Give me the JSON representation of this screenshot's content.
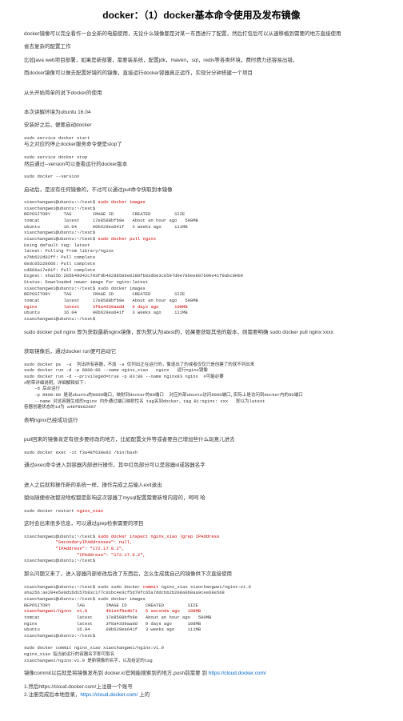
{
  "title": "docker：（1）docker基本命令使用及发布镜像",
  "p1": "docker镜像可以完全看作一台全新的电脑使用，无论什么镜像都是对某一东西进行了配置，然后打包后可以从速移植到需要的地方直接使用",
  "p2": "省去复杂的配置工作",
  "p3": "比如java web项目部署，如果是新部署，需要装系统，配置jdk，maven，sql，redis等各类环境，费时费力还容易出错，",
  "p4": "而docker镜像可以做去配置好镜的的镜像，直接运行docker容器真正运作，实现分分钟搭建一个项目",
  "p5": "从头开始简单的说下docker的使用",
  "p6": "本次讲解环境为ubuntu 16.04",
  "p7": "安装好之后，便要启动docker",
  "c8": "sudo service docker start",
  "p9": "与之对应的停止docker服务命令便是stop了",
  "c10": "sudo service docker stop",
  "p11": "然后通过--version可以查看运行的docker版本",
  "c12": "sudo docker --version",
  "p13": "启动后，是没有任何镜像的，不过可以通过pull命令快取到本镜像",
  "cmd1_line1": "xiaochangwei@ubuntu:~/test$ ",
  "cmd1_line1_red": "sudo docker images",
  "cmd1_line2": "xiaochangwei@ubuntu:~/test$",
  "cmd1_line3": "REPOSITORY     TAG        IMAGE ID       CREATED         SIZE",
  "cmd1_line4": "tomcat         latest     17e8588bfb9e   About an hour ago   500MB",
  "cmd1_line5": "ubuntu         16.04      00b629ea641f   3 weeks ago     111MB",
  "cmd1_line6": "xiaochangwei@ubuntu:~/test$",
  "cmd1_line7": "xiaochangwei@ubuntu:~/test$ ",
  "cmd1_line7_red": "sudo docker pull nginx",
  "cmd1_line8": "Using default tag: latest",
  "cmd1_line9": "latest: Pulling from library/nginx",
  "cmd1_line10": "e7bb522d92ff: Pull complete",
  "cmd1_line11": "6edc05228666: Pull complete",
  "cmd1_line12": "cd866a17e81f: Pull complete",
  "cmd1_line13": "Digest: sha256:285b49d42c703fdb46288586e0288fb83dbe3c6597d0e78bee887600e41f9abc0Hb0",
  "cmd1_line14": "Status: Downloaded newer image for nginx:latest",
  "cmd1_line15": "xiaochangwei@ubuntu:~/test$ sudo docker images",
  "cmd1_line16": "REPOSITORY     TAG        IMAGE ID       CREATED         SIZE",
  "cmd1_line17": "tomcat         latest     17e8588bfb9e   About an hour ago   500MB",
  "cmd1_line18a": "nginx          ",
  "cmd1_line18b": "latest     ",
  "cmd1_line18c": "3f8a4339aadd   ",
  "cmd1_line18d": "9 days ago      108MB",
  "cmd1_line19": "ubuntu         16.04      00b629ea641f   3 weeks ago     111MB",
  "cmd1_line20": "xiaochangwei@ubuntu:~/test$",
  "p14": "sudo docker pull nginx 即为获取最新nginx镜像，即为默认为latest的，如果要获取其他的版本，则需要明确 sudo docker pull nginx:xxxx",
  "p15": "获取镜像后，通过docker run便可启动它",
  "cmd2_line1": "sudo docker ps  -a  列出所有容器，不加 -a 仅列出正在运行的，像退出了的或者仅仅只是创建了的就不列出来",
  "cmd2_line2": "sudo docker run -d -p 8800:80 --name nginx_xiao   nginx   运行nginx镜像",
  "cmd2_line3": "sudo docker run -d --privileged=true -p 83:80 --name nginx83 nginx  #可能必要",
  "cmd2_line4": "#附带详细说明，详细解释如下:",
  "cmd2_line5": "    -d 后台运行",
  "cmd2_line6": "    -p 8800:80 是说ubuntu的8800端口，映射到docker的80端口  对应外部ubuntu访问8800端口,实际上是访问到docker内的80端口",
  "cmd2_line7": "    --name 对这容器生成的nginx 内外通过端口映射性名 tag名到docker，tag B1:nginx: xxx   即以为latest",
  "cmd2_line8": "容器创建状态的id为 a48f8b82d97",
  "p16": "表明nginx已经成功运行",
  "p17": "pull回来的镜像肯定有很多要修改的地方，比如配置文件等或者要自己增加些什么玩意儿进去",
  "cmd2_line9": "sudo docker exec -it f3a48f638e83 /bin/bash",
  "p18": "通过exec命令进入到容器内部进行操作，其中红色部分可以是容器id或容器名字",
  "p19": "进入之后就和操作新的系统一样，操作完成之后输入exit退出",
  "p20": "貌似随便修改都没啥权都是影响这次容器了mysql配置需要新增内容的，呵呵 哈",
  "cmd3_line1": "sudo docker restart ",
  "cmd3_line1_red": "nginx_xiao",
  "p21": "这时会出来很多信息，可以通过grep检索需要的项目",
  "cmd4_line1": "xiaochangwei@ubuntu:~/test$ ",
  "cmd4_line1_red": "sudo docker inspect nginx_xiao |grep IPAddress",
  "cmd4_line2": "            \"SecondaryIPAddresses\": null,",
  "cmd4_line3": "            \"IPAddress\": \"172.17.0.2\",",
  "cmd4_line4": "                    \"IPAddress\": \"172.17.0.2\",",
  "cmd4_line5": "xiaochangwei@ubuntu:~/test$",
  "p22": "那么问题又来了，进入容器内部修改后改了东西后，怎么生成我自己的镜像供下次直接使用",
  "cmd5_line1": "xiaochangwei@ubuntu:~/test$ sudo sudo docker ",
  "cmd5_line1_red": "commit",
  "cmd5_line1b": " nginx_xiao xiaochangwei/nginx:v1.0",
  "cmd5_line2": "sha256:ae284e5e0d1bd157b83c177c01bc4e3cf5d79fc65a7ddcbb2b208a0b0aa9cee68e568",
  "cmd5_line3": "xiaochangwei@ubuntu:~/test$ sudo docker images",
  "cmd5_line4": "REPOSITORY          TAG        IMAGE ID       CREATED         SIZE",
  "cmd5_line5a": "xiaochangwei/nginx  v1.0       ",
  "cmd5_line5b": "461e4f9a4b71   ",
  "cmd5_line5c": "5 seconds ago   108MB",
  "cmd5_line6": "tomcat              latest     17e8588bfb9e   About an hour ago   500MB",
  "cmd5_line7": "nginx               latest     3f8a4339aadd   9 days ago      108MB",
  "cmd5_line8": "ubuntu              16.04      00b629ea641f   3 weeks ago     111MB",
  "cmd5_line9": "xiaochangwei@ubuntu:~/test$",
  "cmd5_line10": "sudo docker commit nginx_xiao xiaochangwei/nginx:v1.0",
  "cmd5_line11": "nginx_xiao 指当前运行的容器名字即可取名",
  "cmd5_line12": "xiaochangwei/nginx:v1.0 是新镜像的名字，以及给定的tag",
  "p23a": "镜像commit以后就是将镜像发布到 docker.io官网能搜索到的地方,push前需要 到",
  "p23b": "https://cloud.docker.com/",
  "p24a": "1.然后https://cloud.docker.com/上注册一个账号",
  "p24b": "2.注册完成后本地登录，",
  "p24c": "https://cloud.docker.com/",
  "p24d": "上的"
}
